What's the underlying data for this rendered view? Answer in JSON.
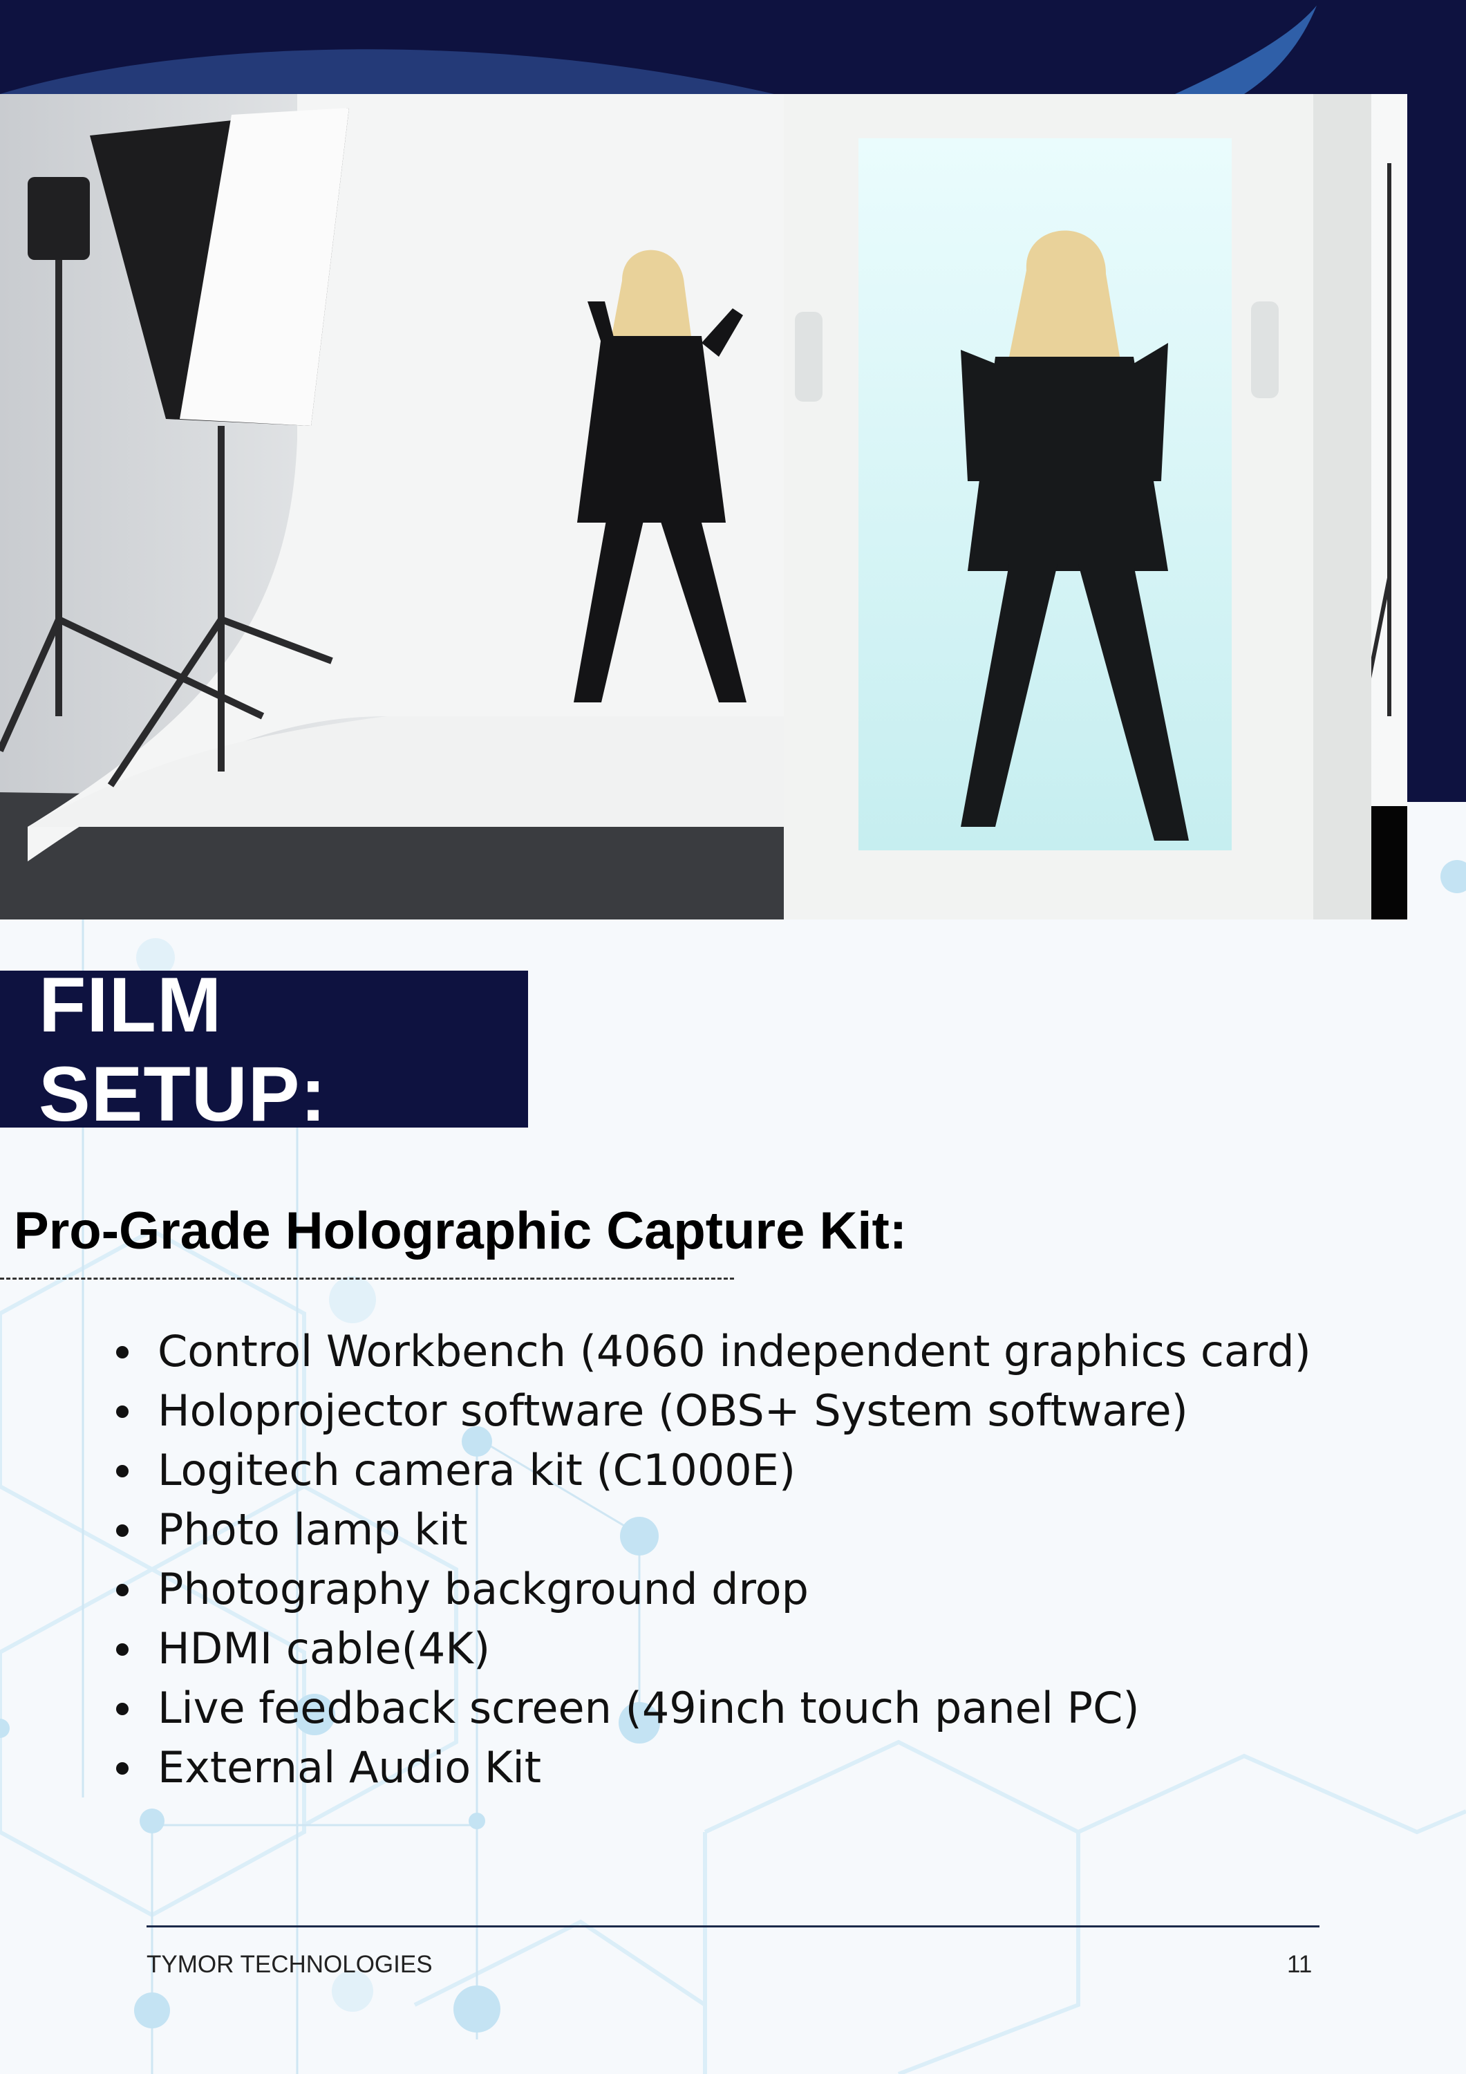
{
  "colors": {
    "navy": "#0e1240",
    "accent": "#2f5fa8",
    "pattern": "#bfe0f2"
  },
  "hero_image": {
    "alt_icon": "hologram-display-photo",
    "description_icon": "studio-hologram-image"
  },
  "title": "FILM SETUP:",
  "subheading": "Pro-Grade Holographic Capture Kit:",
  "kit_items": [
    "Control Workbench (4060 independent graphics card)",
    "Holoprojector software (OBS+ System software)",
    "Logitech camera kit (C1000E)",
    "Photo lamp kit",
    "Photography background drop",
    "HDMI cable(4K)",
    "Live feedback screen (49inch touch panel PC)",
    "External Audio Kit"
  ],
  "footer": {
    "company": "TYMOR TECHNOLOGIES",
    "page_number": "11"
  }
}
